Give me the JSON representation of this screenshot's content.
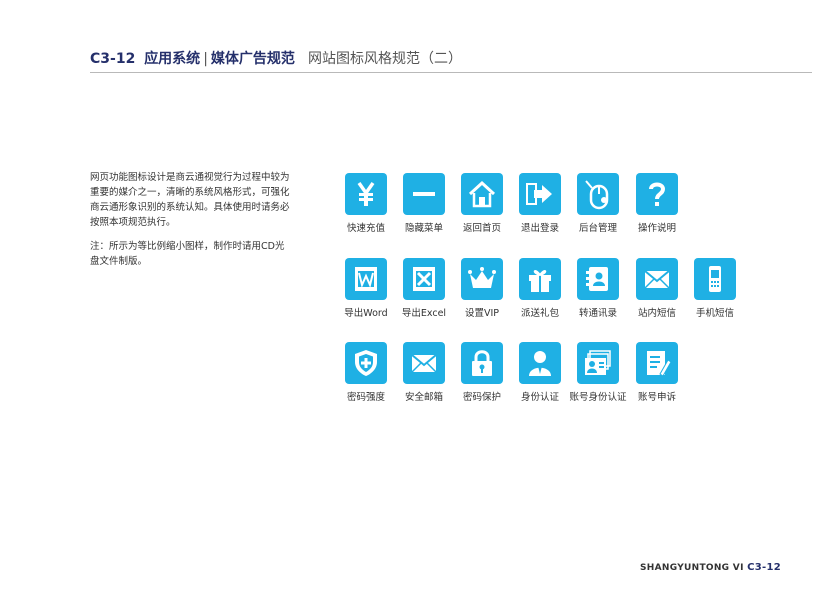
{
  "header": {
    "code": "C3-12",
    "section": "应用系统",
    "separator": "|",
    "chapter": "媒体广告规范",
    "subtitle": "网站图标风格规范（二）"
  },
  "description": {
    "paragraph1": "网页功能图标设计是商云通视觉行为过程中较为重要的媒介之一，清晰的系统风格形式，可强化商云通形象识别的系统认知。具体使用时请务必按照本项规范执行。",
    "paragraph2": "注：所示为等比例缩小图样，制作时请用CD光盘文件制版。"
  },
  "colors": {
    "tile": "#1fb0e4",
    "heading": "#25306b"
  },
  "icons": [
    {
      "label": "快速充值",
      "icon": "yen-icon"
    },
    {
      "label": "隐藏菜单",
      "icon": "minus-icon"
    },
    {
      "label": "返回首页",
      "icon": "home-icon"
    },
    {
      "label": "退出登录",
      "icon": "logout-arrow-icon"
    },
    {
      "label": "后台管理",
      "icon": "mouse-icon"
    },
    {
      "label": "操作说明",
      "icon": "question-icon"
    },
    {
      "label": "导出Word",
      "icon": "word-icon"
    },
    {
      "label": "导出Excel",
      "icon": "excel-icon"
    },
    {
      "label": "设置VIP",
      "icon": "crown-icon"
    },
    {
      "label": "派送礼包",
      "icon": "gift-icon"
    },
    {
      "label": "转通讯录",
      "icon": "contacts-icon"
    },
    {
      "label": "站内短信",
      "icon": "envelope-icon"
    },
    {
      "label": "手机短信",
      "icon": "mobile-phone-icon"
    },
    {
      "label": "密码强度",
      "icon": "shield-icon"
    },
    {
      "label": "安全邮箱",
      "icon": "mail-icon"
    },
    {
      "label": "密码保护",
      "icon": "lock-icon"
    },
    {
      "label": "身份认证",
      "icon": "person-icon"
    },
    {
      "label": "账号身份认证",
      "icon": "id-cards-icon"
    },
    {
      "label": "账号申诉",
      "icon": "appeal-document-icon"
    }
  ],
  "footer": {
    "brand": "SHANGYUNTONG VI",
    "code": "C3-12"
  }
}
